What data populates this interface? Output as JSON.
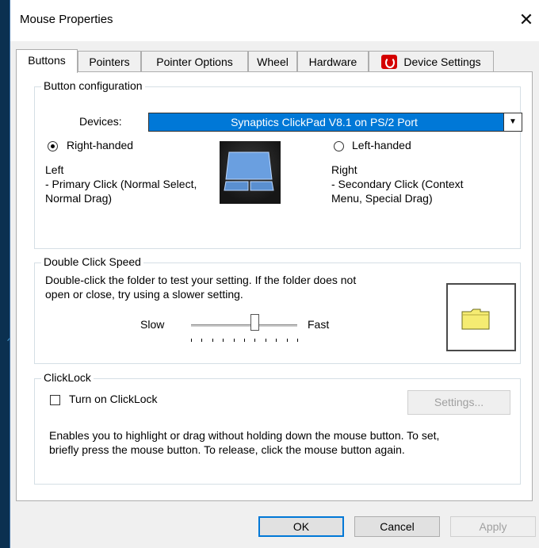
{
  "window": {
    "title": "Mouse Properties",
    "close_glyph": "✕"
  },
  "tabs": [
    "Buttons",
    "Pointers",
    "Pointer Options",
    "Wheel",
    "Hardware",
    "Device Settings"
  ],
  "button_config": {
    "legend": "Button configuration",
    "devices_label": "Devices:",
    "device_value": "Synaptics ClickPad V8.1 on PS/2 Port",
    "right_handed_label": "Right-handed",
    "left_handed_label": "Left-handed",
    "right_handed_selected": true,
    "left_title": "Left",
    "left_desc_1": " - Primary Click (Normal Select,",
    "left_desc_2": "Normal Drag)",
    "right_title": "Right",
    "right_desc_1": " - Secondary Click (Context",
    "right_desc_2": "Menu, Special Drag)"
  },
  "double_click": {
    "legend": "Double Click Speed",
    "desc_1": "Double-click the folder to test your setting.  If the folder does not",
    "desc_2": "open or close, try using a slower setting.",
    "slow_label": "Slow",
    "fast_label": "Fast",
    "speed_fraction": 0.6
  },
  "clicklock": {
    "legend": "ClickLock",
    "checkbox_label": "Turn on ClickLock",
    "checked": false,
    "settings_label": "Settings...",
    "desc_1": "Enables you to highlight or drag without holding down the mouse button.  To set,",
    "desc_2": "briefly press the mouse button.  To release, click the mouse button again."
  },
  "footer": {
    "ok": "OK",
    "cancel": "Cancel",
    "apply": "Apply"
  },
  "colors": {
    "accent": "#0078d7",
    "background": "#0b3050",
    "folder": "#f5ec72"
  }
}
